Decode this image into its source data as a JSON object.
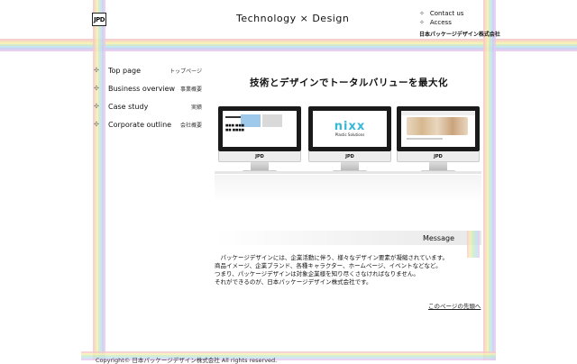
{
  "header": {
    "logo_text": "JPD",
    "tagline": "Technology × Design",
    "links": [
      {
        "label": "Contact us"
      },
      {
        "label": "Access"
      }
    ],
    "company_name": "日本パッケージデザイン株式会社"
  },
  "nav": {
    "items": [
      {
        "label": "Top page",
        "sub": "トップページ"
      },
      {
        "label": "Business overview",
        "sub": "事業概要"
      },
      {
        "label": "Case study",
        "sub": "実績"
      },
      {
        "label": "Corporate outline",
        "sub": "会社概要"
      }
    ]
  },
  "main": {
    "headline": "技術とデザインでトータルバリューを最大化",
    "monitors": [
      {
        "chin_label": "JPD"
      },
      {
        "chin_label": "JPD",
        "brand": "nixx",
        "brand_sub": "Plastic Solutions"
      },
      {
        "chin_label": "JPD"
      }
    ],
    "message_title": "Message",
    "message_lines": [
      "　パッケージデザインには、企業活動に伴う、様々なデザイン要素が凝縮されています。",
      "商品イメージ、企業ブランド、各種キャラクター、ホームページ、イベントなどなど。",
      "つまり、パッケージデザインは対象企業様を知り尽くさなければなりません。",
      "それができるのが、日本パッケージデザイン株式会社です。"
    ],
    "back_to_top": "このページの先頭へ"
  },
  "footer": {
    "copyright": "Copyright© 日本パッケージデザイン株式会社 All rights reserved."
  }
}
